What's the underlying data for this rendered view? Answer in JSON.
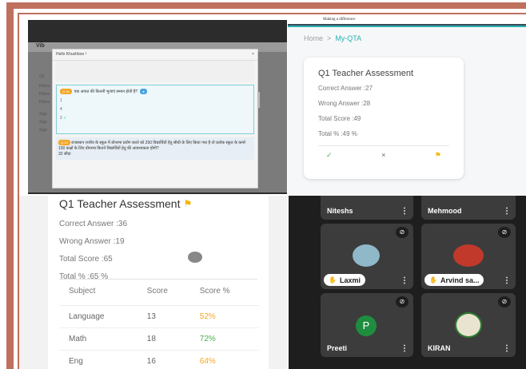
{
  "screen_share": {
    "app_logo": "Vib",
    "greeting": "Hello Khushboo !",
    "close": "×",
    "question_num": "Q.16",
    "question_text": "एक आयत की कितनी भुजाएं समान होती है?",
    "options": [
      "1",
      "4",
      "2"
    ],
    "next_question_num": "Q.19",
    "next_question_text": "राजस्थान राजीव के स्कूल में डोनरमा प्रयोग करते को 250 विद्यार्थियों हेतु सीधी के लिए किया गया है तो प्रत्येक स्कूल के कमरे 100 कक्षों के लिए डोनरमा कितने विद्यार्थियों हेतु की आवश्यकता होगी?",
    "answer_hint": "32 सौदा",
    "side_items": [
      "Q1",
      "Home",
      "Home",
      "Home",
      "Sign",
      "Sign",
      "Sign"
    ]
  },
  "qta": {
    "tagline": "Making a difference",
    "breadcrumb_home": "Home",
    "breadcrumb_sep": ">",
    "breadcrumb_current": "My-QTA",
    "title": "Q1 Teacher Assessment",
    "correct": "Correct Answer :27",
    "wrong": "Wrong Answer :28",
    "total_score": "Total Score :49",
    "total_pct": "Total % :49 %",
    "icon_check": "✓",
    "icon_cross": "×",
    "icon_flag": "⚑"
  },
  "assessment": {
    "title": "Q1 Teacher Assessment",
    "correct": "Correct Answer :36",
    "wrong": "Wrong Answer :19",
    "total_score": "Total Score :65",
    "total_pct": "Total % :65 %",
    "headers": [
      "Subject",
      "Score",
      "Score %"
    ],
    "rows": [
      {
        "subject": "Language",
        "score": "13",
        "pct": "52%"
      },
      {
        "subject": "Math",
        "score": "18",
        "pct": "72%"
      },
      {
        "subject": "Eng",
        "score": "16",
        "pct": "64%"
      }
    ]
  },
  "meeting": {
    "participants": [
      "Niteshs",
      "Mehmood",
      "Laxmi",
      "Arvind sa...",
      "Preeti",
      "KIRAN"
    ],
    "avatar_letter": "P",
    "more_icon": "⋮",
    "mute_icon": "🔇",
    "hand_icon": "✋"
  }
}
